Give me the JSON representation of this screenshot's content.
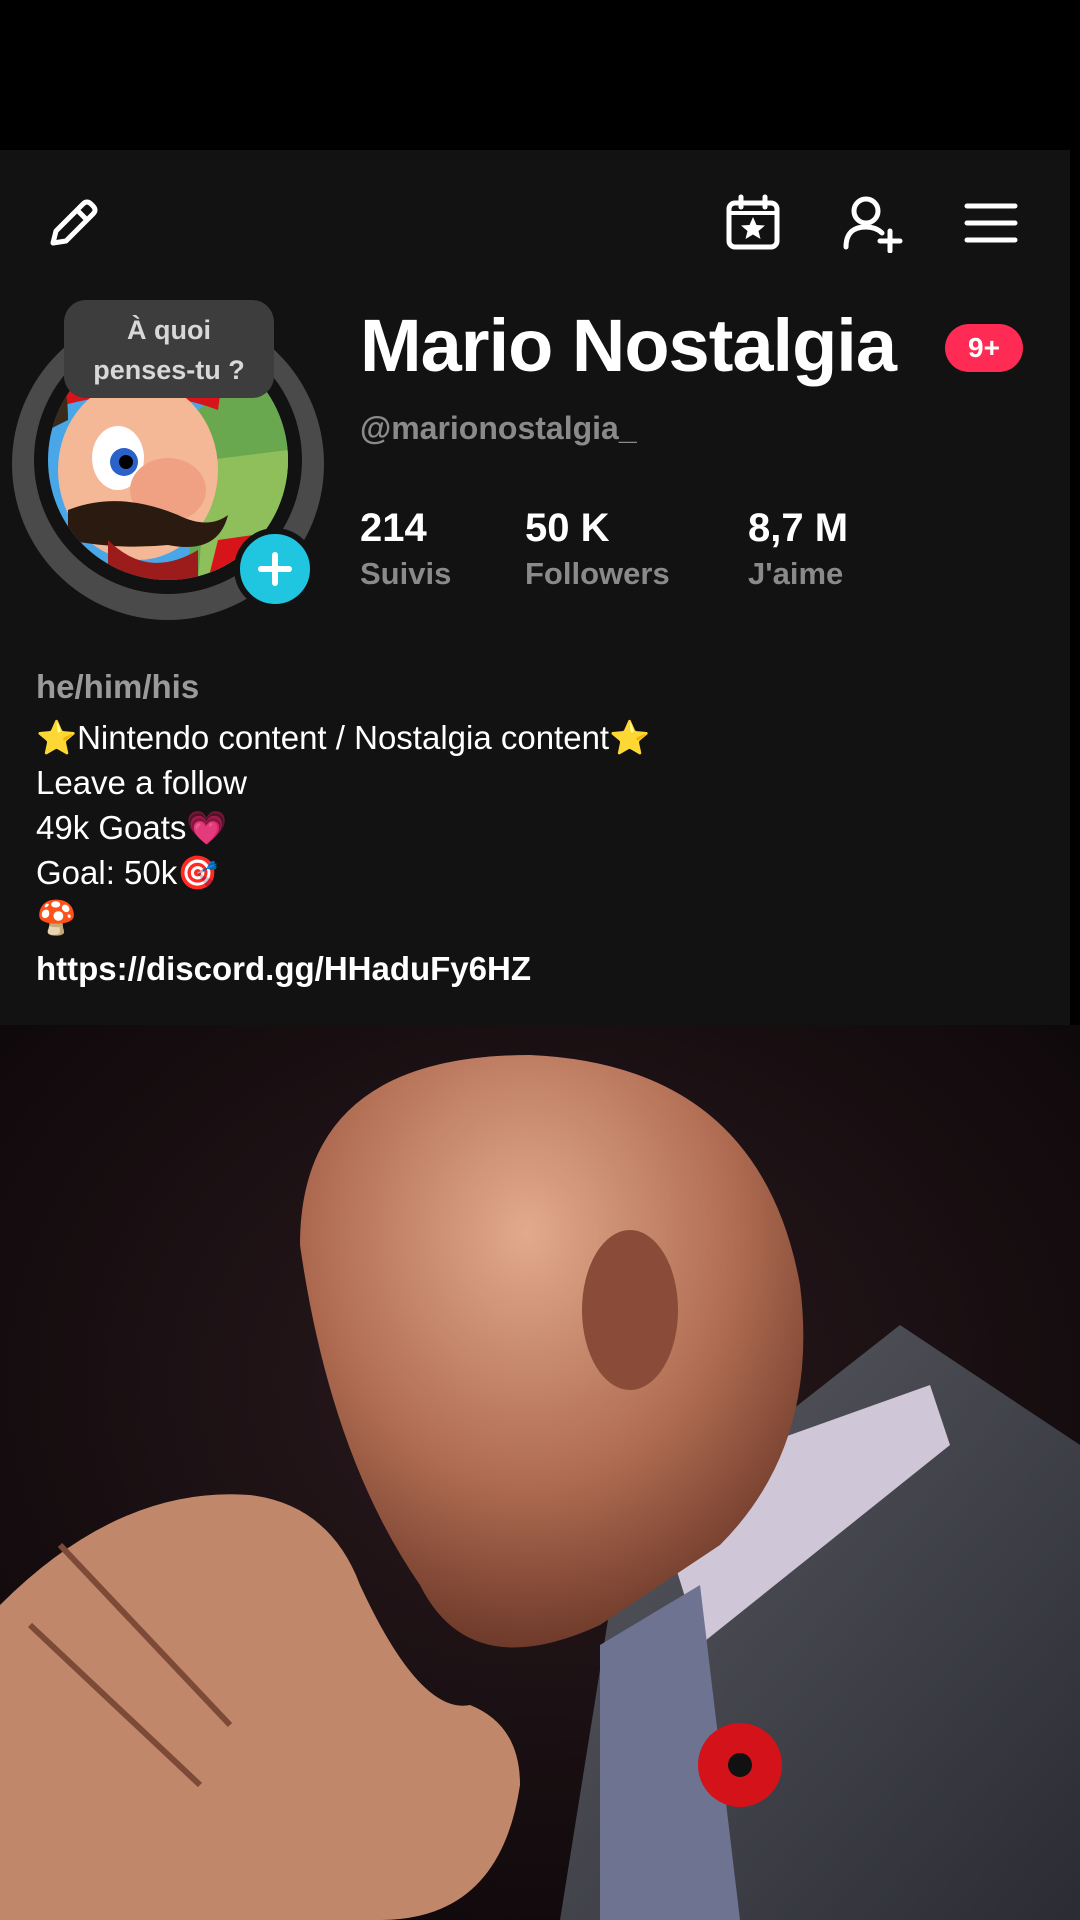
{
  "profile": {
    "name": "Mario Nostalgia",
    "notification_badge": "9+",
    "handle": "@marionostalgia_",
    "thought_bubble": [
      "À quoi",
      "penses-tu ?"
    ],
    "stats": [
      {
        "value": "214",
        "label": "Suivis"
      },
      {
        "value": "50 K",
        "label": "Followers"
      },
      {
        "value": "8,7 M",
        "label": "J'aime"
      }
    ],
    "bio": {
      "pronouns": "he/him/his",
      "lines": [
        "⭐Nintendo content / Nostalgia content⭐",
        "Leave a follow",
        "49k Goats💗",
        "Goal: 50k🎯",
        "🍄"
      ],
      "link": "https://discord.gg/HHaduFy6HZ"
    }
  },
  "icons": {
    "edit": "pencil-icon",
    "calendar": "calendar-star-icon",
    "add_friend": "add-user-icon",
    "menu": "hamburger-menu-icon",
    "avatar_add": "plus-icon"
  },
  "colors": {
    "panel_bg": "#121212",
    "badge": "#ff2b55",
    "avatar_add": "#20c6e0",
    "muted_text": "#8a8a8a"
  }
}
